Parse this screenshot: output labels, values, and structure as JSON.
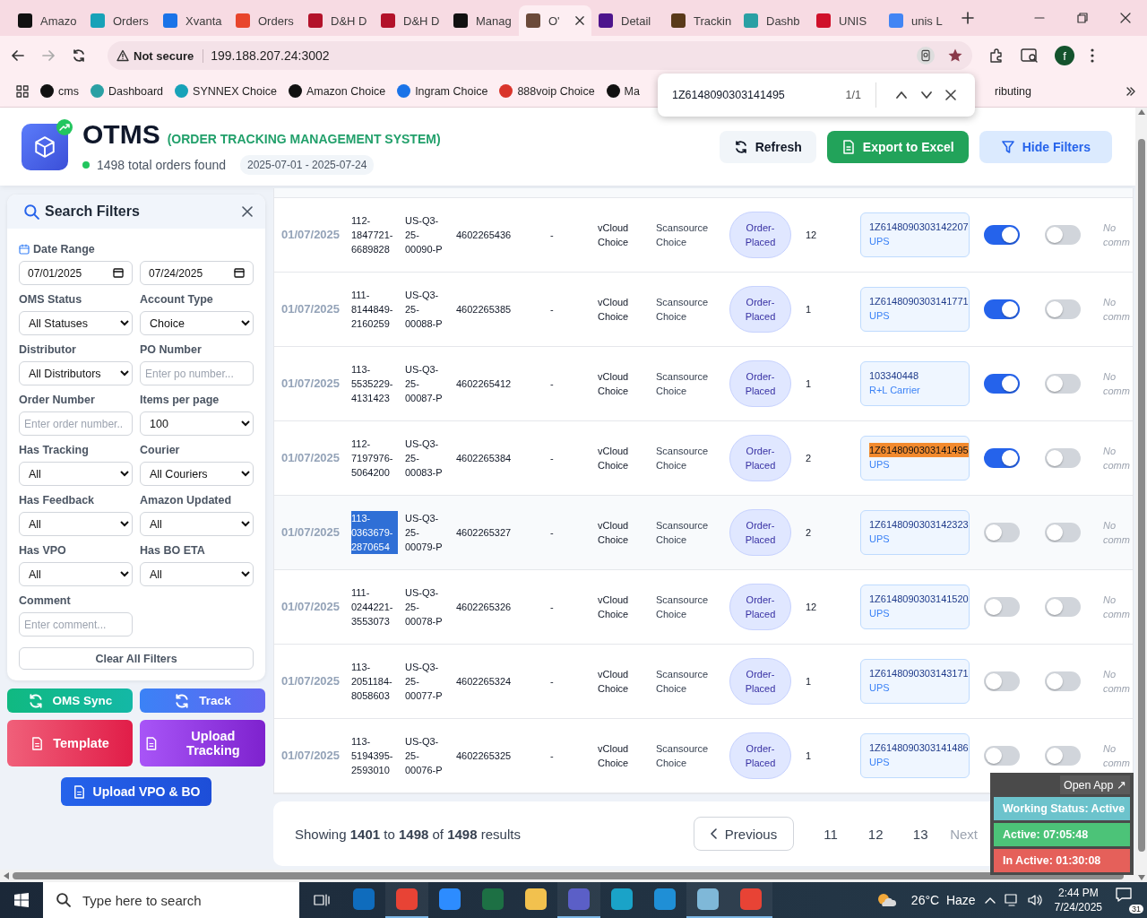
{
  "browser": {
    "tabs": [
      {
        "label": "Amazo",
        "color": "#111111",
        "selected": false
      },
      {
        "label": "Orders",
        "color": "#17a2b8",
        "selected": false
      },
      {
        "label": "Xvanta",
        "color": "#1a73e8",
        "selected": false
      },
      {
        "label": "Orders",
        "color": "#e8452c",
        "selected": false
      },
      {
        "label": "D&H D",
        "color": "#b3122a",
        "selected": false
      },
      {
        "label": "D&H D",
        "color": "#b3122a",
        "selected": false
      },
      {
        "label": "Manag",
        "color": "#111111",
        "selected": false
      },
      {
        "label": "O'",
        "color": "#6b4a3a",
        "selected": true
      },
      {
        "label": "Detail",
        "color": "#4d148c",
        "selected": false
      },
      {
        "label": "Trackin",
        "color": "#5a3a1a",
        "selected": false
      },
      {
        "label": "Dashb",
        "color": "#2aa0a4",
        "selected": false
      },
      {
        "label": "UNIS",
        "color": "#d0102a",
        "selected": false
      },
      {
        "label": "unis L",
        "color": "#4285f4",
        "selected": false
      }
    ],
    "security": "Not secure",
    "url": "199.188.207.24:3002",
    "profile": "f",
    "bookmarks": [
      {
        "label": "cms",
        "color": "#111111"
      },
      {
        "label": "Dashboard",
        "color": "#2aa0a4"
      },
      {
        "label": "SYNNEX Choice",
        "color": "#17a2b8"
      },
      {
        "label": "Amazon Choice",
        "color": "#111111"
      },
      {
        "label": "Ingram Choice",
        "color": "#1a73e8"
      },
      {
        "label": "888voip Choice",
        "color": "#d9342b"
      },
      {
        "label": "Ma",
        "color": "#111111"
      },
      {
        "label": "ributing"
      }
    ],
    "find_bar": {
      "query": "1Z6148090303141495",
      "count": "1/1"
    }
  },
  "app": {
    "title": "OTMS",
    "subtitle": "(ORDER TRACKING MANAGEMENT SYSTEM)",
    "orders_found": "1498 total orders found",
    "date_range": "2025-07-01 - 2025-07-24",
    "actions": [
      {
        "label": "Refresh",
        "kind": "refresh"
      },
      {
        "label": "Export to Excel",
        "kind": "export"
      },
      {
        "label": "Hide Filters",
        "kind": "filter"
      }
    ]
  },
  "filters": {
    "title": "Search Filters",
    "date_label": "Date Range",
    "date_from": "07/01/2025",
    "date_to": "07/24/2025",
    "fields": [
      {
        "label": "OMS Status",
        "kind": "select",
        "value": "All Statuses"
      },
      {
        "label": "Account Type",
        "kind": "select",
        "value": "Choice"
      },
      {
        "label": "Distributor",
        "kind": "select",
        "value": "All Distributors"
      },
      {
        "label": "PO Number",
        "kind": "input",
        "placeholder": "Enter po number..."
      },
      {
        "label": "Order Number",
        "kind": "input",
        "placeholder": "Enter order number.."
      },
      {
        "label": "Items per page",
        "kind": "select",
        "value": "100"
      },
      {
        "label": "Has Tracking",
        "kind": "select",
        "value": "All"
      },
      {
        "label": "Courier",
        "kind": "select",
        "value": "All Couriers"
      },
      {
        "label": "Has Feedback",
        "kind": "select",
        "value": "All"
      },
      {
        "label": "Amazon Updated",
        "kind": "select",
        "value": "All"
      },
      {
        "label": "Has VPO",
        "kind": "select",
        "value": "All"
      },
      {
        "label": "Has BO ETA",
        "kind": "select",
        "value": "All"
      },
      {
        "label": "Comment",
        "kind": "input",
        "placeholder": "Enter comment..."
      }
    ],
    "clear": "Clear All Filters"
  },
  "tools": [
    {
      "label": "OMS Sync",
      "kind": "sync"
    },
    {
      "label": "Track",
      "kind": "track"
    },
    {
      "label": "Template",
      "kind": "template"
    },
    {
      "label": "Upload Tracking",
      "kind": "upload"
    },
    {
      "label": "Upload VPO & BO",
      "kind": "vpo"
    }
  ],
  "table": {
    "rows": [
      {
        "date": "01/07/2025",
        "order_id": "112-1847721-6689828",
        "po": "US-Q3-25-00090-P",
        "column_4": "4602265436",
        "column_5": "-",
        "account": "vCloud Choice",
        "distributor": "Scansource Choice",
        "status": "Order-Placed",
        "quantity": "12",
        "tracking": {
          "number": "1Z6148090303142207",
          "courier": "UPS",
          "highlighted": false
        },
        "toggle_1": true,
        "toggle_2": false,
        "comment": "No comm",
        "selected": false
      },
      {
        "date": "01/07/2025",
        "order_id": "111-8144849-2160259",
        "po": "US-Q3-25-00088-P",
        "column_4": "4602265385",
        "column_5": "-",
        "account": "vCloud Choice",
        "distributor": "Scansource Choice",
        "status": "Order-Placed",
        "quantity": "1",
        "tracking": {
          "number": "1Z6148090303141771",
          "courier": "UPS",
          "highlighted": false
        },
        "toggle_1": true,
        "toggle_2": false,
        "comment": "No comm",
        "selected": false
      },
      {
        "date": "01/07/2025",
        "order_id": "113-5535229-4131423",
        "po": "US-Q3-25-00087-P",
        "column_4": "4602265412",
        "column_5": "-",
        "account": "vCloud Choice",
        "distributor": "Scansource Choice",
        "status": "Order-Placed",
        "quantity": "1",
        "tracking": {
          "number": "103340448",
          "courier": "R+L Carrier",
          "highlighted": false
        },
        "toggle_1": true,
        "toggle_2": false,
        "comment": "No comm",
        "selected": false
      },
      {
        "date": "01/07/2025",
        "order_id": "112-7197976-5064200",
        "po": "US-Q3-25-00083-P",
        "column_4": "4602265384",
        "column_5": "-",
        "account": "vCloud Choice",
        "distributor": "Scansource Choice",
        "status": "Order-Placed",
        "quantity": "2",
        "tracking": {
          "number": "1Z6148090303141495",
          "courier": "UPS",
          "highlighted": true
        },
        "toggle_1": true,
        "toggle_2": false,
        "comment": "No comm",
        "selected": false
      },
      {
        "date": "01/07/2025",
        "order_id": "113-0363679-2870654",
        "po": "US-Q3-25-00079-P",
        "column_4": "4602265327",
        "column_5": "-",
        "account": "vCloud Choice",
        "distributor": "Scansource Choice",
        "status": "Order-Placed",
        "quantity": "2",
        "tracking": {
          "number": "1Z6148090303142323",
          "courier": "UPS",
          "highlighted": false
        },
        "toggle_1": false,
        "toggle_2": false,
        "comment": "No comm",
        "selected": true
      },
      {
        "date": "01/07/2025",
        "order_id": "111-0244221-3553073",
        "po": "US-Q3-25-00078-P",
        "column_4": "4602265326",
        "column_5": "-",
        "account": "vCloud Choice",
        "distributor": "Scansource Choice",
        "status": "Order-Placed",
        "quantity": "12",
        "tracking": {
          "number": "1Z6148090303141520",
          "courier": "UPS",
          "highlighted": false
        },
        "toggle_1": false,
        "toggle_2": false,
        "comment": "No comm",
        "selected": false
      },
      {
        "date": "01/07/2025",
        "order_id": "113-2051184-8058603",
        "po": "US-Q3-25-00077-P",
        "column_4": "4602265324",
        "column_5": "-",
        "account": "vCloud Choice",
        "distributor": "Scansource Choice",
        "status": "Order-Placed",
        "quantity": "1",
        "tracking": {
          "number": "1Z6148090303143171",
          "courier": "UPS",
          "highlighted": false
        },
        "toggle_1": false,
        "toggle_2": false,
        "comment": "No comm",
        "selected": false
      },
      {
        "date": "01/07/2025",
        "order_id": "113-5194395-2593010",
        "po": "US-Q3-25-00076-P",
        "column_4": "4602265325",
        "column_5": "-",
        "account": "vCloud Choice",
        "distributor": "Scansource Choice",
        "status": "Order-Placed",
        "quantity": "1",
        "tracking": {
          "number": "1Z6148090303141486",
          "courier": "UPS",
          "highlighted": false
        },
        "toggle_1": false,
        "toggle_2": false,
        "comment": "No comm",
        "selected": false
      }
    ]
  },
  "pagination": {
    "summary": "Showing **1401** to **1498** of **1498** results",
    "previous": "Previous",
    "pages": [
      {
        "label": "11",
        "selected": false
      },
      {
        "label": "12",
        "selected": false
      },
      {
        "label": "13",
        "selected": false
      }
    ],
    "next": "Next"
  },
  "status_widget": {
    "open_app": "Open App ↗",
    "working_status": "Working Status: Active",
    "active": "Active: 07:05:48",
    "inactive": "In Active: 01:30:08"
  },
  "taskbar": {
    "search_placeholder": "Type here to search",
    "apps": [
      {
        "color": "#0f6cbd",
        "running": false
      },
      {
        "color": "#e84335",
        "running": true
      },
      {
        "color": "#2d8cff",
        "running": false
      },
      {
        "color": "#1d7044",
        "running": false
      },
      {
        "color": "#f2c14e",
        "running": false
      },
      {
        "color": "#5b5fc7",
        "running": true
      },
      {
        "color": "#1aa3c8",
        "running": false
      },
      {
        "color": "#1f8fd6",
        "running": false
      },
      {
        "color": "#7fb8d8",
        "running": true
      },
      {
        "color": "#e84335",
        "running": true
      }
    ],
    "weather": "26°C  Haze",
    "time": "2:44 PM",
    "date": "7/24/2025",
    "notifications": "31"
  }
}
